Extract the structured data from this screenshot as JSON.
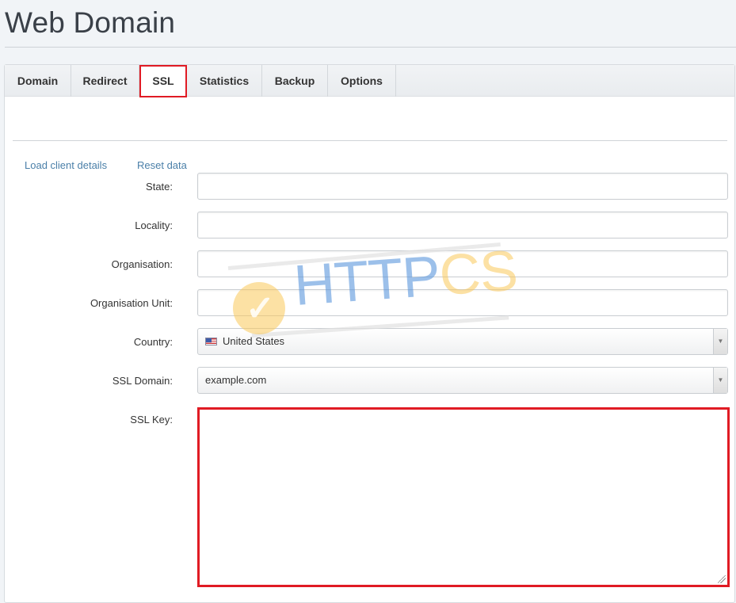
{
  "header": {
    "title": "Web Domain"
  },
  "tabs": [
    {
      "label": "Domain",
      "active": false
    },
    {
      "label": "Redirect",
      "active": false
    },
    {
      "label": "SSL",
      "active": true
    },
    {
      "label": "Statistics",
      "active": false
    },
    {
      "label": "Backup",
      "active": false
    },
    {
      "label": "Options",
      "active": false
    }
  ],
  "links": {
    "load_client_details": "Load client details",
    "reset_data": "Reset data"
  },
  "form": {
    "state": {
      "label": "State:",
      "value": ""
    },
    "locality": {
      "label": "Locality:",
      "value": ""
    },
    "organisation": {
      "label": "Organisation:",
      "value": ""
    },
    "organisation_unit": {
      "label": "Organisation Unit:",
      "value": ""
    },
    "country": {
      "label": "Country:",
      "value": "United States",
      "flag_icon": "us-flag-icon"
    },
    "ssl_domain": {
      "label": "SSL Domain:",
      "value": "example.com"
    },
    "ssl_key": {
      "label": "SSL Key:",
      "value": ""
    }
  },
  "watermark": {
    "text_a": "HTTP",
    "text_b": "CS"
  },
  "colors": {
    "highlight": "#e01b24",
    "link": "#4a7fa8"
  }
}
